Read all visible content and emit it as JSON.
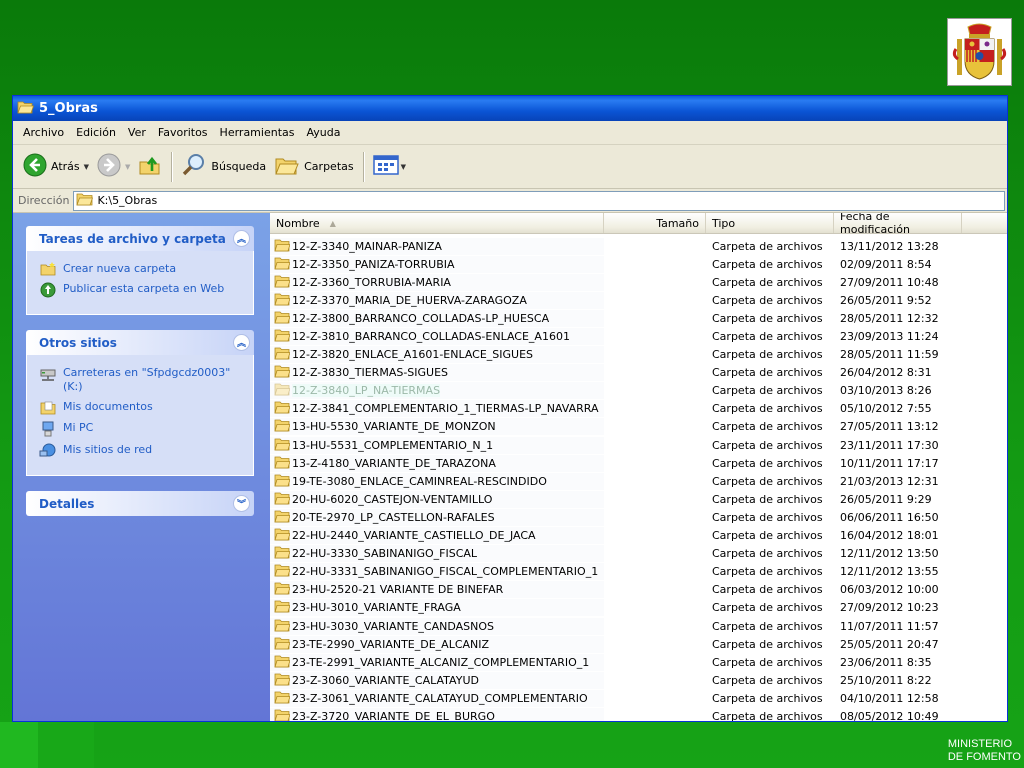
{
  "window": {
    "title": "5_Obras"
  },
  "menu": [
    "Archivo",
    "Edición",
    "Ver",
    "Favoritos",
    "Herramientas",
    "Ayuda"
  ],
  "toolbar": {
    "back_label": "Atrás",
    "search_label": "Búsqueda",
    "folders_label": "Carpetas"
  },
  "address": {
    "label": "Dirección",
    "path": "K:\\5_Obras"
  },
  "taskpane": {
    "tasks": {
      "title": "Tareas de archivo y carpeta",
      "items": [
        "Crear nueva carpeta",
        "Publicar esta carpeta en Web"
      ]
    },
    "other": {
      "title": "Otros sitios",
      "items": [
        "Carreteras en \"Sfpdgcdz0003\" (K:)",
        "Mis documentos",
        "Mi PC",
        "Mis sitios de red"
      ]
    },
    "details": {
      "title": "Detalles"
    }
  },
  "columns": {
    "name": "Nombre",
    "size": "Tamaño",
    "type": "Tipo",
    "date": "Fecha de modificación"
  },
  "files": [
    {
      "name": "12-Z-3340_MAINAR-PANIZA",
      "type": "Carpeta de archivos",
      "date": "13/11/2012 13:28"
    },
    {
      "name": "12-Z-3350_PANIZA-TORRUBIA",
      "type": "Carpeta de archivos",
      "date": "02/09/2011 8:54"
    },
    {
      "name": "12-Z-3360_TORRUBIA-MARIA",
      "type": "Carpeta de archivos",
      "date": "27/09/2011 10:48"
    },
    {
      "name": "12-Z-3370_MARIA_DE_HUERVA-ZARAGOZA",
      "type": "Carpeta de archivos",
      "date": "26/05/2011 9:52"
    },
    {
      "name": "12-Z-3800_BARRANCO_COLLADAS-LP_HUESCA",
      "type": "Carpeta de archivos",
      "date": "28/05/2011 12:32"
    },
    {
      "name": "12-Z-3810_BARRANCO_COLLADAS-ENLACE_A1601",
      "type": "Carpeta de archivos",
      "date": "23/09/2013 11:24"
    },
    {
      "name": "12-Z-3820_ENLACE_A1601-ENLACE_SIGUES",
      "type": "Carpeta de archivos",
      "date": "28/05/2011 11:59"
    },
    {
      "name": "12-Z-3830_TIERMAS-SIGUES",
      "type": "Carpeta de archivos",
      "date": "26/04/2012 8:31"
    },
    {
      "name": "12-Z-3840_LP_NA-TIERMAS",
      "type": "Carpeta de archivos",
      "date": "03/10/2013 8:26",
      "cut": true
    },
    {
      "name": "12-Z-3841_COMPLEMENTARIO_1_TIERMAS-LP_NAVARRA",
      "type": "Carpeta de archivos",
      "date": "05/10/2012 7:55"
    },
    {
      "name": "13-HU-5530_VARIANTE_DE_MONZON",
      "type": "Carpeta de archivos",
      "date": "27/05/2011 13:12"
    },
    {
      "name": "13-HU-5531_COMPLEMENTARIO_N_1",
      "type": "Carpeta de archivos",
      "date": "23/11/2011 17:30"
    },
    {
      "name": "13-Z-4180_VARIANTE_DE_TARAZONA",
      "type": "Carpeta de archivos",
      "date": "10/11/2011 17:17"
    },
    {
      "name": "19-TE-3080_ENLACE_CAMINREAL-RESCINDIDO",
      "type": "Carpeta de archivos",
      "date": "21/03/2013 12:31"
    },
    {
      "name": "20-HU-6020_CASTEJON-VENTAMILLO",
      "type": "Carpeta de archivos",
      "date": "26/05/2011 9:29"
    },
    {
      "name": "20-TE-2970_LP_CASTELLON-RAFALES",
      "type": "Carpeta de archivos",
      "date": "06/06/2011 16:50"
    },
    {
      "name": "22-HU-2440_VARIANTE_CASTIELLO_DE_JACA",
      "type": "Carpeta de archivos",
      "date": "16/04/2012 18:01"
    },
    {
      "name": "22-HU-3330_SABINANIGO_FISCAL",
      "type": "Carpeta de archivos",
      "date": "12/11/2012 13:50"
    },
    {
      "name": "22-HU-3331_SABINANIGO_FISCAL_COMPLEMENTARIO_1",
      "type": "Carpeta de archivos",
      "date": "12/11/2012 13:55"
    },
    {
      "name": "23-HU-2520-21 VARIANTE DE BINEFAR",
      "type": "Carpeta de archivos",
      "date": "06/03/2012 10:00"
    },
    {
      "name": "23-HU-3010_VARIANTE_FRAGA",
      "type": "Carpeta de archivos",
      "date": "27/09/2012 10:23"
    },
    {
      "name": "23-HU-3030_VARIANTE_CANDASNOS",
      "type": "Carpeta de archivos",
      "date": "11/07/2011 11:57"
    },
    {
      "name": "23-TE-2990_VARIANTE_DE_ALCANIZ",
      "type": "Carpeta de archivos",
      "date": "25/05/2011 20:47"
    },
    {
      "name": "23-TE-2991_VARIANTE_ALCANIZ_COMPLEMENTARIO_1",
      "type": "Carpeta de archivos",
      "date": "23/06/2011 8:35"
    },
    {
      "name": "23-Z-3060_VARIANTE_CALATAYUD",
      "type": "Carpeta de archivos",
      "date": "25/10/2011 8:22"
    },
    {
      "name": "23-Z-3061_VARIANTE_CALATAYUD_COMPLEMENTARIO",
      "type": "Carpeta de archivos",
      "date": "04/10/2011 12:58"
    },
    {
      "name": "23-Z-3720_VARIANTE_DE_EL_BURGO",
      "type": "Carpeta de archivos",
      "date": "08/05/2012 10:49"
    }
  ],
  "footer": {
    "line1": "MINISTERIO",
    "line2": "DE FOMENTO"
  },
  "colors": {
    "slide_green": "#1e8e1e",
    "xp_title": "#0b55d5",
    "taskpane_link": "#215dc6"
  }
}
